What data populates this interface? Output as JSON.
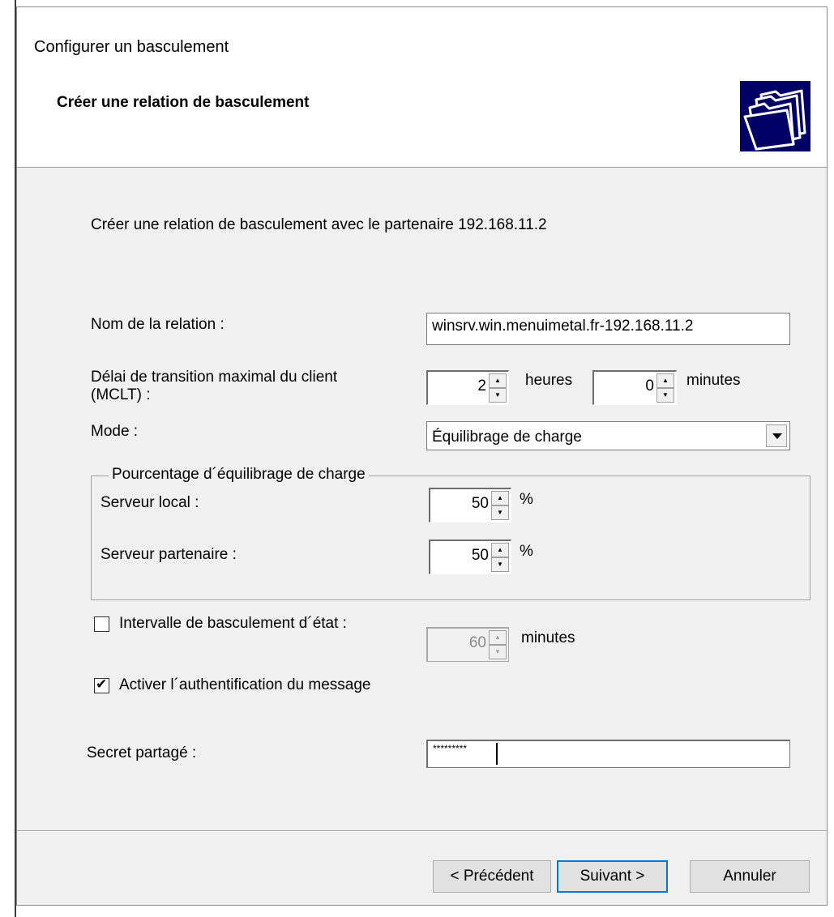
{
  "window": {
    "title": "Configurer un basculement"
  },
  "header": {
    "title": "Créer une relation de basculement",
    "icon": "wizard-folders-icon"
  },
  "intro": "Créer une relation de basculement avec le partenaire 192.168.11.2",
  "relation": {
    "label": "Nom de la relation :",
    "value": "winsrv.win.menuimetal.fr-192.168.11.2"
  },
  "mclt": {
    "label_line1": "Délai de transition maximal du client",
    "label_line2": "(MCLT) :",
    "hours": "2",
    "hours_unit": "heures",
    "minutes": "0",
    "minutes_unit": "minutes"
  },
  "mode": {
    "label": "Mode :",
    "value": "Équilibrage de charge"
  },
  "load_balance": {
    "group_label": "Pourcentage d´équilibrage de charge",
    "local_label": "Serveur local :",
    "local_value": "50",
    "local_unit": "%",
    "partner_label": "Serveur partenaire :",
    "partner_value": "50",
    "partner_unit": "%"
  },
  "state_interval": {
    "label": "Intervalle de basculement d´état :",
    "checked": false,
    "value": "60",
    "unit": "minutes"
  },
  "auth": {
    "label": "Activer l´authentification du message",
    "checked": true
  },
  "secret": {
    "label": "Secret partagé :",
    "value": "*********"
  },
  "buttons": {
    "back": "< Précédent",
    "next": "Suivant >",
    "cancel": "Annuler"
  },
  "colors": {
    "accent": "#0078d7",
    "icon_bg": "#000066"
  }
}
